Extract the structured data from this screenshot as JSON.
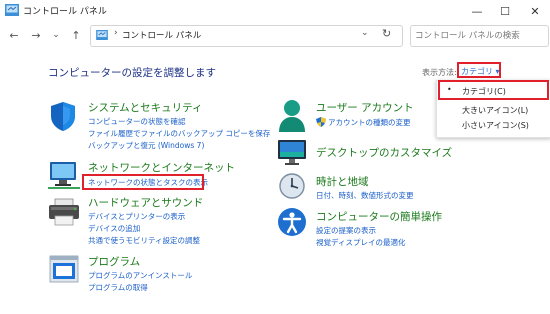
{
  "window": {
    "title": "コントロール パネル",
    "minimize_glyph": "—",
    "maximize_glyph": "☐",
    "close_glyph": "✕"
  },
  "nav": {
    "back_glyph": "←",
    "forward_glyph": "→",
    "history_glyph": "⌄",
    "up_glyph": "↑",
    "separator_glyph": "›",
    "address_path": "コントロール パネル",
    "address_chevron": "⌄",
    "refresh_glyph": "↻",
    "search_placeholder": "コントロール パネルの検索"
  },
  "main": {
    "heading": "コンピューターの設定を調整します",
    "view_by_label": "表示方法:",
    "view_by_value": "カテゴリ ▾"
  },
  "view_menu": {
    "bullet": "•",
    "items": [
      "カテゴリ(C)",
      "大きいアイコン(L)",
      "小さいアイコン(S)"
    ]
  },
  "categories_left": [
    {
      "title": "システムとセキュリティ",
      "links": [
        "コンピューターの状態を確認",
        "ファイル履歴でファイルのバックアップ コピーを保存",
        "バックアップと復元 (Windows 7)"
      ]
    },
    {
      "title": "ネットワークとインターネット",
      "links": [
        "ネットワークの状態とタスクの表示"
      ]
    },
    {
      "title": "ハードウェアとサウンド",
      "links": [
        "デバイスとプリンターの表示",
        "デバイスの追加",
        "共通で使うモビリティ設定の調整"
      ]
    },
    {
      "title": "プログラム",
      "links": [
        "プログラムのアンインストール",
        "プログラムの取得"
      ]
    }
  ],
  "categories_right": [
    {
      "title": "ユーザー アカウント",
      "links": [
        "アカウントの種類の変更"
      ]
    },
    {
      "title": "デスクトップのカスタマイズ",
      "links": []
    },
    {
      "title": "時計と地域",
      "links": [
        "日付、時刻、数値形式の変更"
      ]
    },
    {
      "title": "コンピューターの簡単操作",
      "links": [
        "設定の提案の表示",
        "視覚ディスプレイの最適化"
      ]
    }
  ],
  "colors": {
    "category_title": "#1a7a1a",
    "link": "#1a5fc9",
    "heading": "#1e3287",
    "highlight_box": "#e0202a"
  }
}
